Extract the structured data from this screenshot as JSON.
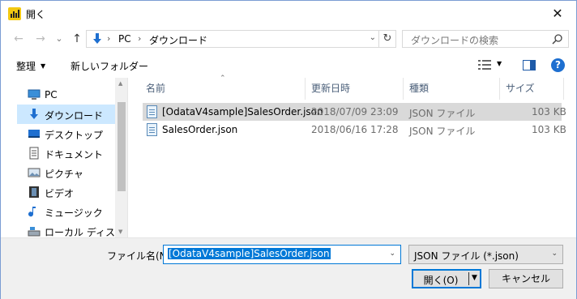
{
  "window": {
    "title": "開く",
    "close_symbol": "✕"
  },
  "nav": {
    "back_symbol": "←",
    "forward_symbol": "→",
    "recent_symbol": "⌄",
    "up_symbol": "↑",
    "breadcrumb": [
      "PC",
      "ダウンロード"
    ],
    "search_placeholder": "ダウンロードの検索"
  },
  "toolbar": {
    "organize": "整理",
    "new_folder": "新しいフォルダー"
  },
  "sidebar": {
    "items": [
      {
        "label": "PC",
        "icon": "pc-icon",
        "selected": false
      },
      {
        "label": "ダウンロード",
        "icon": "downloads-icon",
        "selected": true
      },
      {
        "label": "デスクトップ",
        "icon": "desktop-icon",
        "selected": false
      },
      {
        "label": "ドキュメント",
        "icon": "documents-icon",
        "selected": false
      },
      {
        "label": "ピクチャ",
        "icon": "pictures-icon",
        "selected": false
      },
      {
        "label": "ビデオ",
        "icon": "videos-icon",
        "selected": false
      },
      {
        "label": "ミュージック",
        "icon": "music-icon",
        "selected": false
      },
      {
        "label": "ローカル ディスク (C",
        "icon": "disk-icon",
        "selected": false
      }
    ]
  },
  "columns": {
    "name": "名前",
    "modified": "更新日時",
    "type": "種類",
    "size": "サイズ"
  },
  "files": [
    {
      "name": "[OdataV4sample]SalesOrder.json",
      "modified": "2018/07/09 23:09",
      "type": "JSON ファイル",
      "size": "103 KB",
      "selected": true
    },
    {
      "name": "SalesOrder.json",
      "modified": "2018/06/16 17:28",
      "type": "JSON ファイル",
      "size": "103 KB",
      "selected": false
    }
  ],
  "footer": {
    "filename_label": "ファイル名(N):",
    "filename_value": "[OdataV4sample]SalesOrder.json",
    "filetype_value": "JSON ファイル (*.json)",
    "open_label": "開く(O)",
    "cancel_label": "キャンセル"
  },
  "colors": {
    "accent": "#0078d7",
    "selection": "#cce8ff",
    "row_selection": "#d9d9d9"
  }
}
